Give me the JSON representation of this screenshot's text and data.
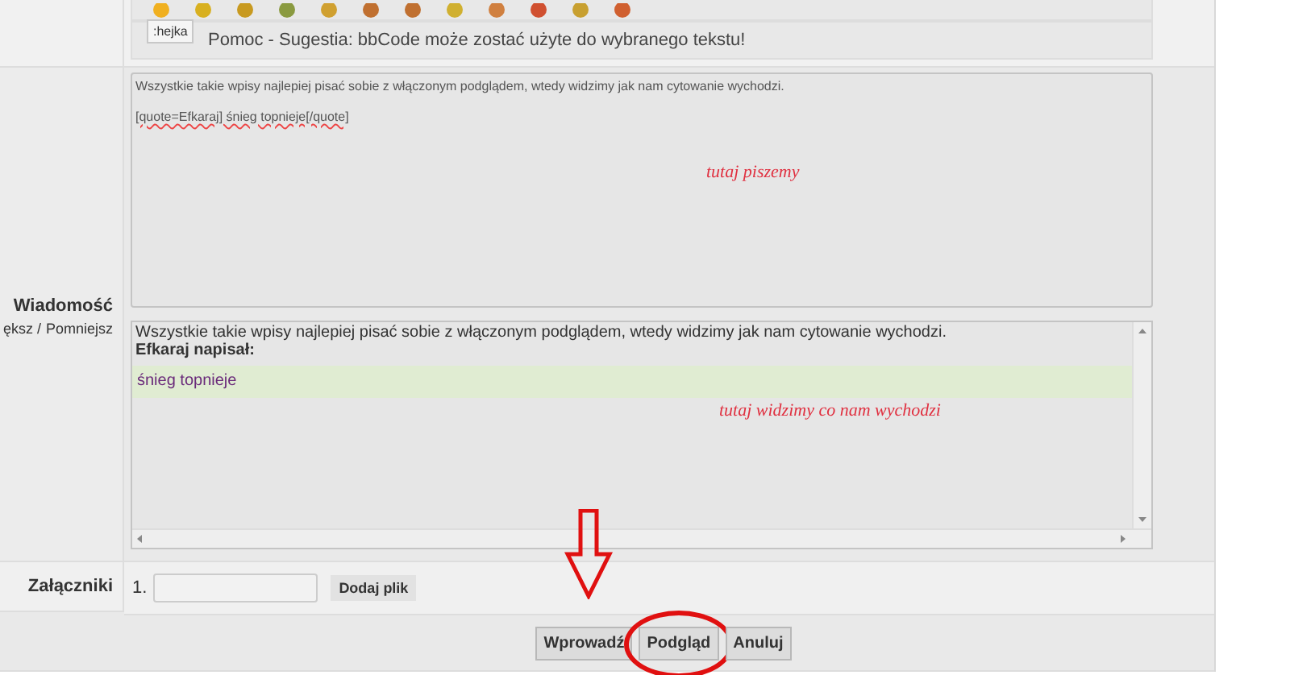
{
  "smiley_bar": {
    "tooltip": ":hejka"
  },
  "bbcode_help": "Pomoc - Sugestia: bbCode może zostać użyte do wybranego tekstu!",
  "message": {
    "label": "Wiadomość",
    "resize_links": [
      "ększ /",
      "Pomniejsz"
    ],
    "editor_lines": [
      "Wszystkie takie wpisy najlepiej pisać sobie z włączonym podglądem, wtedy widzimy jak nam cytowanie wychodzi.",
      "[quote=Efkaraj] śnieg topnieje[/quote]"
    ],
    "editor_note": "tutaj piszemy",
    "preview": {
      "text": "Wszystkie takie wpisy najlepiej pisać sobie z włączonym podglądem, wtedy widzimy jak nam cytowanie wychodzi.",
      "quote_author": "Efkaraj napisał:",
      "quote_text": "śnieg topnieje",
      "note": "tutaj widzimy co nam wychodzi"
    }
  },
  "attachments": {
    "label": "Załączniki",
    "index": "1.",
    "button": "Dodaj plik"
  },
  "buttons": [
    {
      "label": "Wprowadź",
      "highlighted": false
    },
    {
      "label": "Podgląd",
      "highlighted": true
    },
    {
      "label": "Anuluj",
      "highlighted": false
    }
  ]
}
